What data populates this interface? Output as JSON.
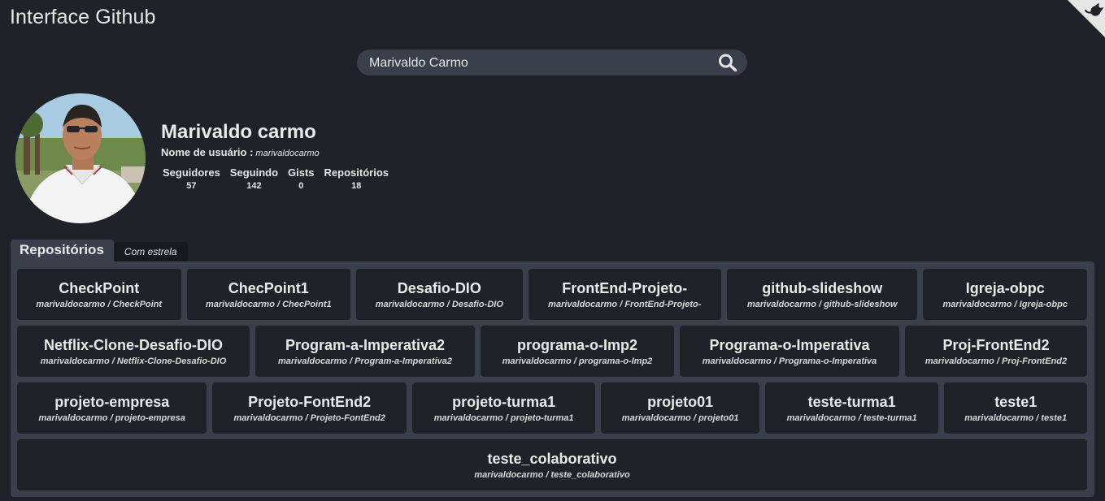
{
  "app": {
    "title": "Interface Github"
  },
  "search": {
    "value": "Marivaldo Carmo",
    "icon": "search-icon"
  },
  "profile": {
    "name": "Marivaldo carmo",
    "username_label": "Nome de usuário :",
    "username": "marivaldocarmo",
    "stats": [
      {
        "label": "Seguidores",
        "value": "57"
      },
      {
        "label": "Seguindo",
        "value": "142"
      },
      {
        "label": "Gists",
        "value": "0"
      },
      {
        "label": "Repositórios",
        "value": "18"
      }
    ]
  },
  "tabs": [
    {
      "label": "Repositórios",
      "active": true
    },
    {
      "label": "Com estrela",
      "active": false
    }
  ],
  "repositories": [
    {
      "name": "CheckPoint",
      "path": "marivaldocarmo / CheckPoint"
    },
    {
      "name": "ChecPoint1",
      "path": "marivaldocarmo / ChecPoint1"
    },
    {
      "name": "Desafio-DIO",
      "path": "marivaldocarmo / Desafio-DIO"
    },
    {
      "name": "FrontEnd-Projeto-",
      "path": "marivaldocarmo / FrontEnd-Projeto-"
    },
    {
      "name": "github-slideshow",
      "path": "marivaldocarmo / github-slideshow"
    },
    {
      "name": "Igreja-obpc",
      "path": "marivaldocarmo / Igreja-obpc"
    },
    {
      "name": "Netflix-Clone-Desafio-DIO",
      "path": "marivaldocarmo / Netflix-Clone-Desafio-DIO"
    },
    {
      "name": "Program-a-Imperativa2",
      "path": "marivaldocarmo / Program-a-Imperativa2"
    },
    {
      "name": "programa-o-Imp2",
      "path": "marivaldocarmo / programa-o-Imp2"
    },
    {
      "name": "Programa-o-Imperativa",
      "path": "marivaldocarmo / Programa-o-Imperativa"
    },
    {
      "name": "Proj-FrontEnd2",
      "path": "marivaldocarmo / Proj-FrontEnd2"
    },
    {
      "name": "projeto-empresa",
      "path": "marivaldocarmo / projeto-empresa"
    },
    {
      "name": "Projeto-FontEnd2",
      "path": "marivaldocarmo / Projeto-FontEnd2"
    },
    {
      "name": "projeto-turma1",
      "path": "marivaldocarmo / projeto-turma1"
    },
    {
      "name": "projeto01",
      "path": "marivaldocarmo / projeto01"
    },
    {
      "name": "teste-turma1",
      "path": "marivaldocarmo / teste-turma1"
    },
    {
      "name": "teste1",
      "path": "marivaldocarmo / teste1"
    },
    {
      "name": "teste_colaborativo",
      "path": "marivaldocarmo / teste_colaborativo"
    }
  ],
  "colors": {
    "background": "#1f2229",
    "panel": "#3a3f4b",
    "text": "#e9e9e9"
  }
}
